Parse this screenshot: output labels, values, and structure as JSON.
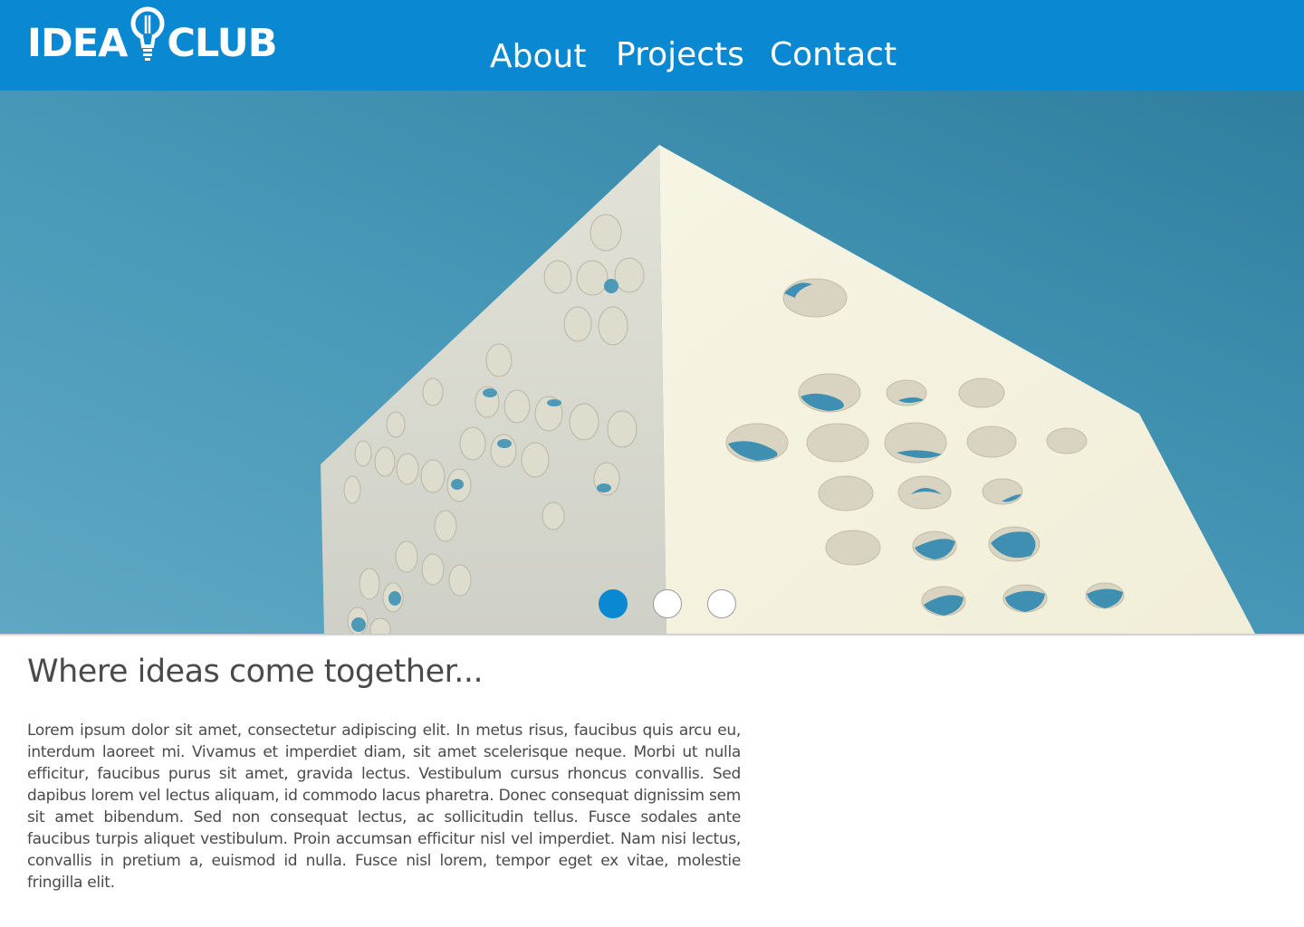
{
  "brand": {
    "word1": "IDEA",
    "word2": "CLUB",
    "logo_icon": "lightbulb-icon"
  },
  "nav": {
    "items": [
      {
        "label": "About"
      },
      {
        "label": "Projects"
      },
      {
        "label": "Contact"
      }
    ]
  },
  "hero": {
    "image": "white-perforated-building-against-blue-sky",
    "carousel": {
      "slide_count": 3,
      "active_index": 0
    }
  },
  "main": {
    "headline": "Where ideas come together...",
    "body": "Lorem ipsum dolor sit amet, consectetur adipiscing elit. In metus risus, faucibus quis arcu eu, interdum laoreet mi. Vivamus et imperdiet diam, sit amet scelerisque neque. Morbi ut nulla efficitur, faucibus purus sit amet, gravida lectus. Vestibulum cursus rhoncus convallis. Sed dapibus lorem vel lectus aliquam, id commodo lacus pharetra. Donec consequat dignissim sem sit amet bibendum. Sed non consequat lectus, ac sollicitudin tellus. Fusce sodales ante faucibus turpis aliquet vestibulum. Proin accumsan efficitur nisl vel imperdiet. Nam nisi lectus, convallis in pretium a, euismod id nulla. Fusce nisl lorem, tempor eget ex vitae, molestie fringilla elit."
  },
  "colors": {
    "brand_blue": "#0a88d2",
    "sky_blue": "#4b9fbd",
    "text_gray": "#4a4a4a",
    "building_white": "#f4f1e2"
  }
}
